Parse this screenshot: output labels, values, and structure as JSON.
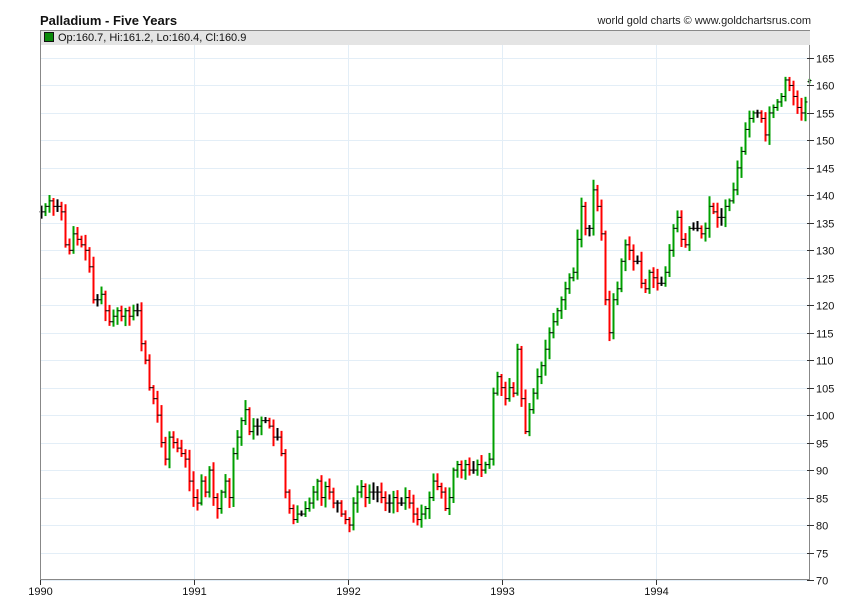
{
  "header": {
    "title": "Palladium - Five Years",
    "credit": "world gold charts © www.goldchartsrus.com",
    "ohlc_readout": "Op:160.7, Hi:161.2, Lo:160.4, Cl:160.9"
  },
  "colors": {
    "up": "#00a000",
    "down": "#ff0000",
    "grid": "#e3eef7",
    "legend_bg": "#e4e4e4"
  },
  "chart_data": {
    "type": "ohlc",
    "title": "Palladium - Five Years",
    "xlabel": "",
    "ylabel": "",
    "x_range": [
      1990,
      1995
    ],
    "ylim": [
      70,
      165
    ],
    "y_ticks": [
      70,
      75,
      80,
      85,
      90,
      95,
      100,
      105,
      110,
      115,
      120,
      125,
      130,
      135,
      140,
      145,
      150,
      155,
      160,
      165
    ],
    "x_ticks": [
      "1990",
      "1991",
      "1992",
      "1993",
      "1994"
    ],
    "grid": true,
    "axis_position": "right",
    "last_bar": {
      "open": 160.7,
      "high": 161.2,
      "low": 160.4,
      "close": 160.9
    },
    "closes": [
      137,
      138,
      139,
      138,
      138,
      137,
      131,
      130,
      133,
      132,
      131,
      130,
      127,
      121,
      121,
      122,
      119,
      117,
      118,
      119,
      118,
      119,
      118,
      119,
      119,
      113,
      110,
      105,
      103,
      100,
      95,
      92,
      96,
      95,
      94,
      93,
      92,
      88,
      85,
      84,
      88,
      86,
      90,
      85,
      83,
      86,
      88,
      85,
      93,
      96,
      99,
      101,
      97,
      98,
      98,
      99,
      99,
      98,
      96,
      96,
      93,
      86,
      83,
      81,
      82,
      82,
      83,
      84,
      86,
      88,
      85,
      87,
      86,
      84,
      84,
      82,
      81,
      80,
      84,
      86,
      87,
      85,
      86,
      86,
      86,
      85,
      84,
      84,
      85,
      84,
      84,
      85,
      84,
      82,
      81,
      82,
      83,
      85,
      88,
      87,
      86,
      83,
      85,
      90,
      91,
      90,
      91,
      90,
      90,
      91,
      90,
      91,
      92,
      104,
      107,
      105,
      103,
      105,
      104,
      112,
      103,
      97,
      101,
      104,
      107,
      109,
      112,
      115,
      117,
      119,
      121,
      123,
      125,
      126,
      132,
      138,
      134,
      134,
      141,
      138,
      133,
      121,
      115,
      121,
      123,
      128,
      131,
      130,
      128,
      128,
      124,
      123,
      126,
      125,
      124,
      124,
      126,
      130,
      134,
      136,
      132,
      131,
      134,
      134,
      134,
      133,
      134,
      138,
      137,
      136,
      136,
      138,
      139,
      141,
      145,
      148,
      152,
      154,
      155,
      155,
      154,
      151,
      155,
      156,
      157,
      158,
      161,
      160,
      158,
      156,
      155,
      157,
      160.9
    ]
  }
}
